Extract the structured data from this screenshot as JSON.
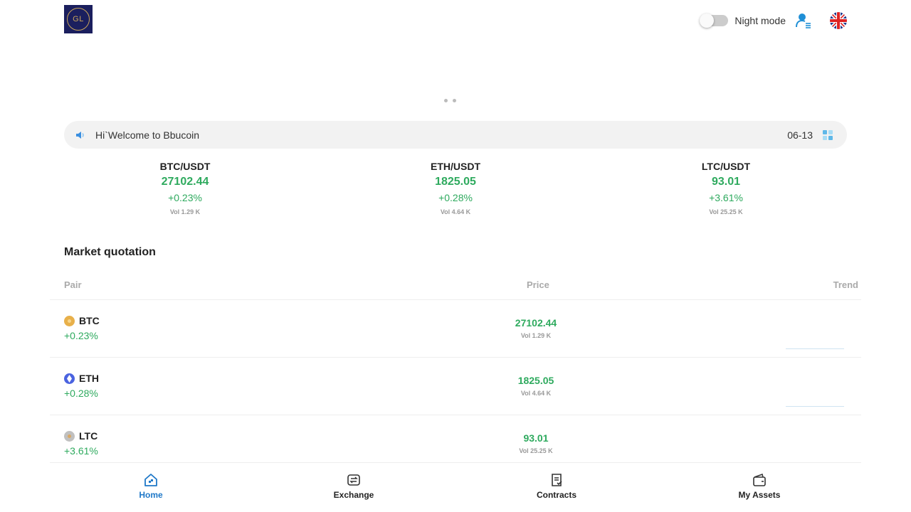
{
  "header": {
    "logo_text": "GL",
    "night_mode_label": "Night mode",
    "night_mode_on": false
  },
  "banner": {
    "slides": 2
  },
  "notice": {
    "text": "Hi`Welcome to Bbucoin",
    "date": "06-13"
  },
  "tickers": [
    {
      "pair": "BTC/USDT",
      "price": "27102.44",
      "change": "+0.23%",
      "volume": "Vol 1.29 K"
    },
    {
      "pair": "ETH/USDT",
      "price": "1825.05",
      "change": "+0.28%",
      "volume": "Vol 4.64 K"
    },
    {
      "pair": "LTC/USDT",
      "price": "93.01",
      "change": "+3.61%",
      "volume": "Vol 25.25 K"
    }
  ],
  "market": {
    "title": "Market quotation",
    "columns": {
      "pair": "Pair",
      "price": "Price",
      "trend": "Trend"
    },
    "rows": [
      {
        "coin": "BTC",
        "change": "+0.23%",
        "price": "27102.44",
        "volume": "Vol 1.29 K"
      },
      {
        "coin": "ETH",
        "change": "+0.28%",
        "price": "1825.05",
        "volume": "Vol 4.64 K"
      },
      {
        "coin": "LTC",
        "change": "+3.61%",
        "price": "93.01",
        "volume": "Vol 25.25 K"
      }
    ]
  },
  "nav": [
    {
      "label": "Home",
      "icon": "home-icon",
      "active": true
    },
    {
      "label": "Exchange",
      "icon": "exchange-icon",
      "active": false
    },
    {
      "label": "Contracts",
      "icon": "contracts-icon",
      "active": false
    },
    {
      "label": "My Assets",
      "icon": "wallet-icon",
      "active": false
    }
  ],
  "colors": {
    "positive": "#2eaa5e",
    "accent": "#1f78c8",
    "logo_bg": "#1b1f5e",
    "btc": "#e8b04a",
    "eth": "#4a63e0",
    "ltc": "#c0c0c0"
  }
}
